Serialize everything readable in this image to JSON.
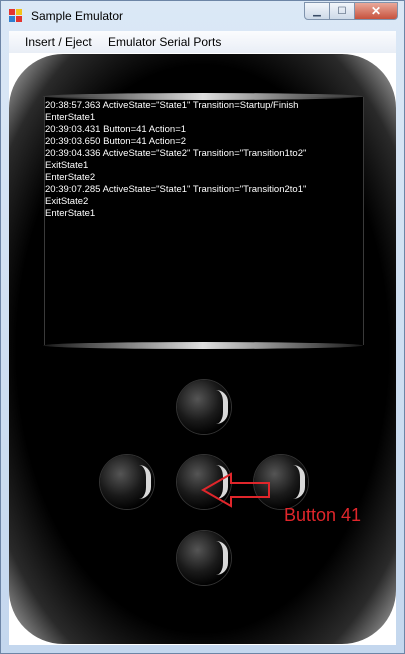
{
  "window": {
    "title": "Sample Emulator"
  },
  "menu": {
    "items": [
      "Insert / Eject",
      "Emulator Serial Ports"
    ]
  },
  "screen": {
    "lines": [
      "20:38:57.363 ActiveState=\"State1\" Transition=Startup/Finish",
      "EnterState1",
      "20:39:03.431 Button=41 Action=1",
      "20:39:03.650 Button=41 Action=2",
      "20:39:04.336 ActiveState=\"State2\" Transition=\"Transition1to2\"",
      "ExitState1",
      "EnterState2",
      "20:39:07.285 ActiveState=\"State1\" Transition=\"Transition2to1\"",
      "ExitState2",
      "EnterState1"
    ]
  },
  "annotation": {
    "label": "Button 41",
    "color": "#e0262b"
  },
  "colors": {
    "device": "#000000",
    "screen_text": "#ffffff"
  }
}
